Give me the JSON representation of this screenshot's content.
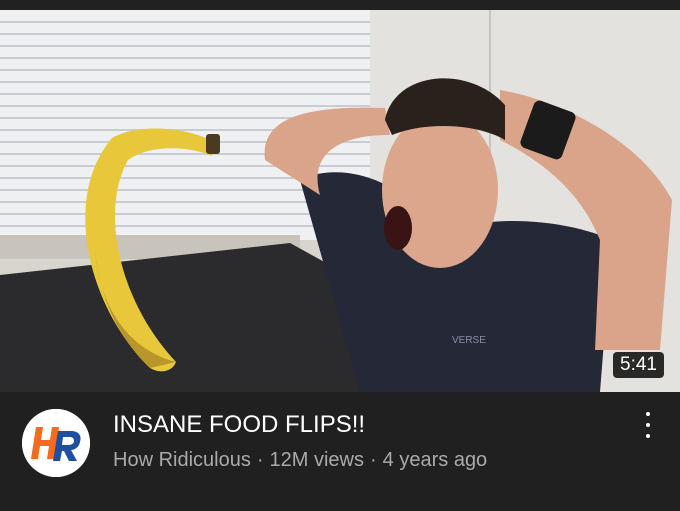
{
  "video": {
    "duration": "5:41",
    "title": "INSANE FOOD FLIPS!!",
    "channel": "How Ridiculous",
    "views": "12M views",
    "age": "4 years ago",
    "separator": "·",
    "shirt_text": "VERSE"
  },
  "icons": {
    "more": "more-vertical-icon",
    "avatar_logo": "HR"
  },
  "colors": {
    "background": "#202020",
    "title": "#ffffff",
    "meta": "#aaaaaa",
    "logo_orange": "#f26b21",
    "logo_blue": "#1f4fa0"
  }
}
